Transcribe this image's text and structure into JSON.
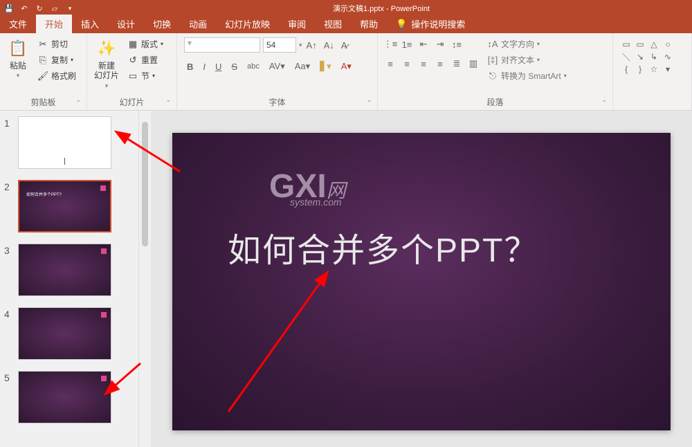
{
  "app": {
    "title": "演示文稿1.pptx - PowerPoint"
  },
  "tabs": [
    "文件",
    "开始",
    "插入",
    "设计",
    "切换",
    "动画",
    "幻灯片放映",
    "审阅",
    "视图",
    "帮助"
  ],
  "tellme": "操作说明搜索",
  "ribbon": {
    "clipboard": {
      "paste": "粘贴",
      "cut": "剪切",
      "copy": "复制",
      "format_painter": "格式刷",
      "label": "剪贴板"
    },
    "slides": {
      "new_slide": "新建\n幻灯片",
      "layout": "版式",
      "reset": "重置",
      "section": "节",
      "label": "幻灯片"
    },
    "font": {
      "size": "54",
      "label": "字体"
    },
    "paragraph": {
      "text_direction": "文字方向",
      "align_text": "对齐文本",
      "smartart": "转换为 SmartArt",
      "label": "段落"
    }
  },
  "thumbnails": {
    "count": 5,
    "slide2_text": "如何合并多个PPT?"
  },
  "slide": {
    "watermark": {
      "brand": "GXI",
      "suffix": "网",
      "sub": "system.com"
    },
    "title": "如何合并多个PPT？"
  }
}
